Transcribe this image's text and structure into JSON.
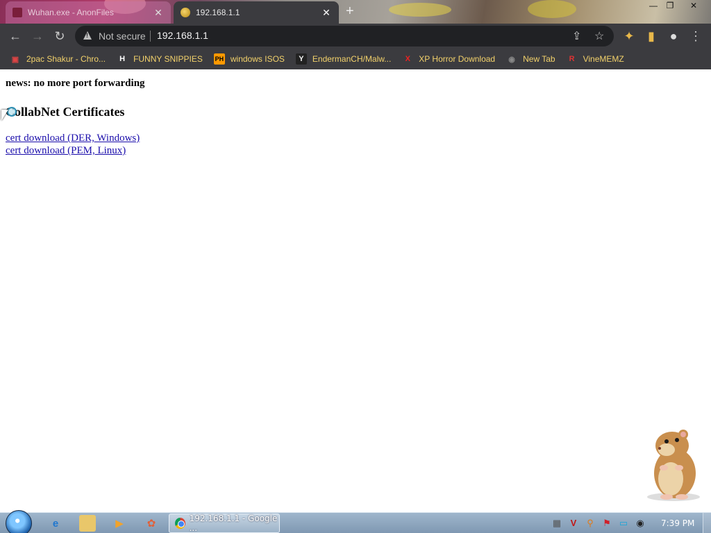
{
  "tabs": [
    {
      "title": "Wuhan.exe - AnonFiles",
      "state": "inactive",
      "close": "✕"
    },
    {
      "title": "192.168.1.1",
      "state": "active",
      "close": "✕"
    }
  ],
  "new_tab": "+",
  "window_controls": {
    "minimize": "—",
    "restore": "❐",
    "close": "✕"
  },
  "toolbar": {
    "back": "←",
    "forward": "→",
    "reload": "↻",
    "security_label": "Not secure",
    "url": "192.168.1.1",
    "share": "⇪",
    "star": "☆",
    "extensions": "✦",
    "sidepanel": "▮",
    "profile": "●",
    "menu": "⋮"
  },
  "bookmarks": [
    {
      "label": "2pac Shakur - Chro...",
      "icon": "news-icon",
      "glyph": "▣",
      "color": "#d44"
    },
    {
      "label": "FUNNY SNIPPIES",
      "icon": "h-icon",
      "glyph": "H",
      "color": "#fff"
    },
    {
      "label": "windows ISOS",
      "icon": "ph-icon",
      "glyph": "PH",
      "color": "#f90"
    },
    {
      "label": "EndermanCH/Malw...",
      "icon": "yt-icon",
      "glyph": "Y",
      "color": "#222"
    },
    {
      "label": "XP Horror Download",
      "icon": "x-icon",
      "glyph": "X",
      "color": "#e22"
    },
    {
      "label": "New Tab",
      "icon": "globe-icon",
      "glyph": "◉",
      "color": "#888"
    },
    {
      "label": "VineMEMZ",
      "icon": "r-icon",
      "glyph": "R",
      "color": "#d33"
    }
  ],
  "page": {
    "news": "news: no more port forwarding",
    "heading": "CollabNet Certificates",
    "links": [
      "cert download (DER, Windows)",
      "cert download (PEM, Linux)"
    ]
  },
  "taskbar": {
    "active_window_label": "192.168.1.1 - Google ...",
    "clock": "7:39 PM",
    "pinned": [
      "ie-icon",
      "explorer-icon",
      "media-player-icon",
      "paint-icon"
    ],
    "tray": [
      "network-icon",
      "v-icon",
      "search-icon",
      "flag-icon",
      "monitor-icon",
      "speaker-icon"
    ]
  },
  "colors": {
    "chrome_dark": "#3b3b3f",
    "bookmark_text": "#f3d26b",
    "link": "#1a0dab"
  }
}
